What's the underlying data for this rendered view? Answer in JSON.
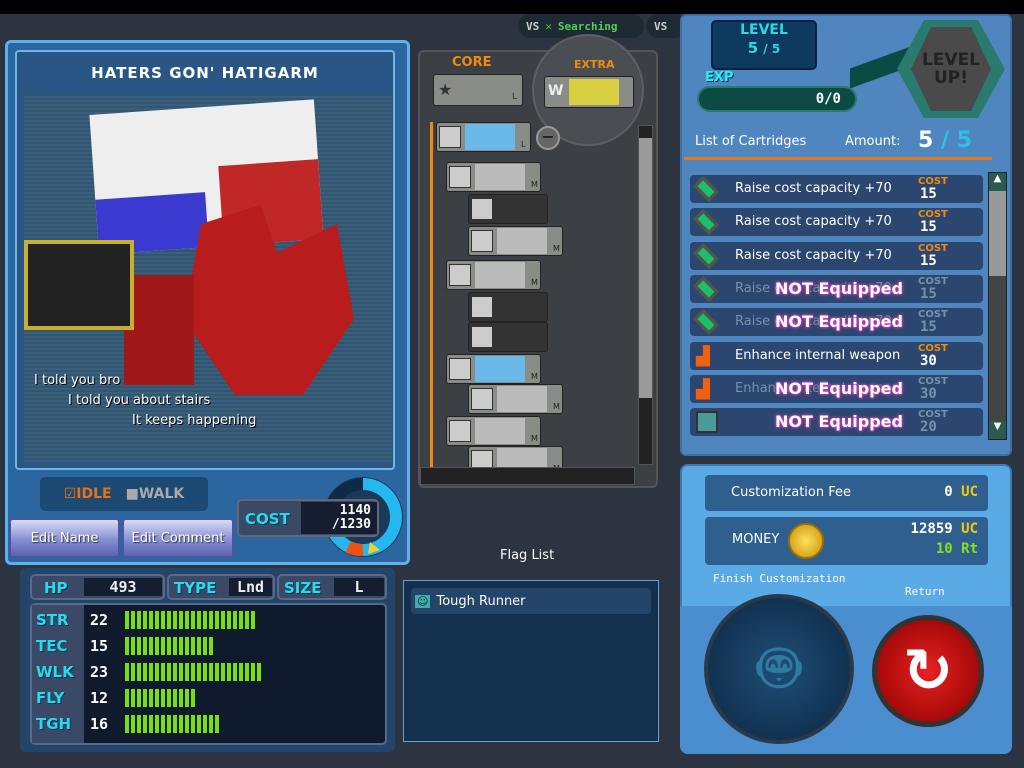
{
  "top": {
    "vs1": "VS",
    "status": "Searching",
    "vs2": "VS"
  },
  "robot": {
    "name": "HATERS GON' HATIGARM",
    "comment": [
      "I told you bro",
      "I told you about stairs",
      "It keeps happening"
    ]
  },
  "anim": {
    "idle": "IDLE",
    "walk": "WALK",
    "idle_checked": true,
    "walk_checked": false
  },
  "buttons": {
    "edit_name": "Edit Name",
    "edit_comment": "Edit Comment",
    "finish": "Finish Customization",
    "return": "Return",
    "level_up": "LEVEL UP!"
  },
  "cost": {
    "label": "COST",
    "current": "1140",
    "max": "/1230",
    "fraction": 0.927
  },
  "stats": {
    "hp_label": "HP",
    "hp": "493",
    "type_label": "TYPE",
    "type": "Lnd",
    "size_label": "SIZE",
    "size": "L",
    "bars": [
      {
        "label": "STR",
        "value": "22",
        "n": 22
      },
      {
        "label": "TEC",
        "value": "15",
        "n": 15
      },
      {
        "label": "WLK",
        "value": "23",
        "n": 23
      },
      {
        "label": "FLY",
        "value": "12",
        "n": 12
      },
      {
        "label": "TGH",
        "value": "16",
        "n": 16
      }
    ]
  },
  "parts": {
    "core": "CORE",
    "extra": "EXTRA",
    "w": "W",
    "size_l": "L",
    "size_m": "M"
  },
  "flags": {
    "title": "Flag List",
    "items": [
      "Tough Runner"
    ]
  },
  "level": {
    "label": "LEVEL",
    "current": "5",
    "max": "/ 5",
    "exp_label": "EXP",
    "exp": "0/0"
  },
  "cartridges": {
    "title": "List of Cartridges",
    "amount_label": "Amount:",
    "amount": "5",
    "amount_max": "5",
    "cost_label": "COST",
    "not_equipped": "NOT Equipped",
    "items": [
      {
        "name": "Raise cost capacity +70",
        "cost": "15",
        "equipped": true,
        "icon": "green-capsule"
      },
      {
        "name": "Raise cost capacity +70",
        "cost": "15",
        "equipped": true,
        "icon": "green-capsule"
      },
      {
        "name": "Raise cost capacity +70",
        "cost": "15",
        "equipped": true,
        "icon": "green-capsule"
      },
      {
        "name": "Raise cost capacity +70",
        "cost": "15",
        "equipped": false,
        "icon": "green-capsule"
      },
      {
        "name": "Raise cost capacity +70",
        "cost": "15",
        "equipped": false,
        "icon": "green-capsule"
      },
      {
        "name": "Enhance internal weapon",
        "cost": "30",
        "equipped": true,
        "icon": "orange-gun"
      },
      {
        "name": "Enhance internal weapon",
        "cost": "30",
        "equipped": false,
        "icon": "orange-gun"
      },
      {
        "name": "",
        "cost": "20",
        "equipped": false,
        "icon": "robot-face"
      }
    ]
  },
  "money": {
    "fee_label": "Customization Fee",
    "fee": "0",
    "uc": "UC",
    "label": "MONEY",
    "uc_amount": "12859",
    "rt_amount": "10",
    "rt": "Rt"
  },
  "colors": {
    "accent": "#2ed8e8",
    "panel": "#2c66a0",
    "cost_orange": "#f08a10",
    "bar_green": "#7adf12"
  }
}
